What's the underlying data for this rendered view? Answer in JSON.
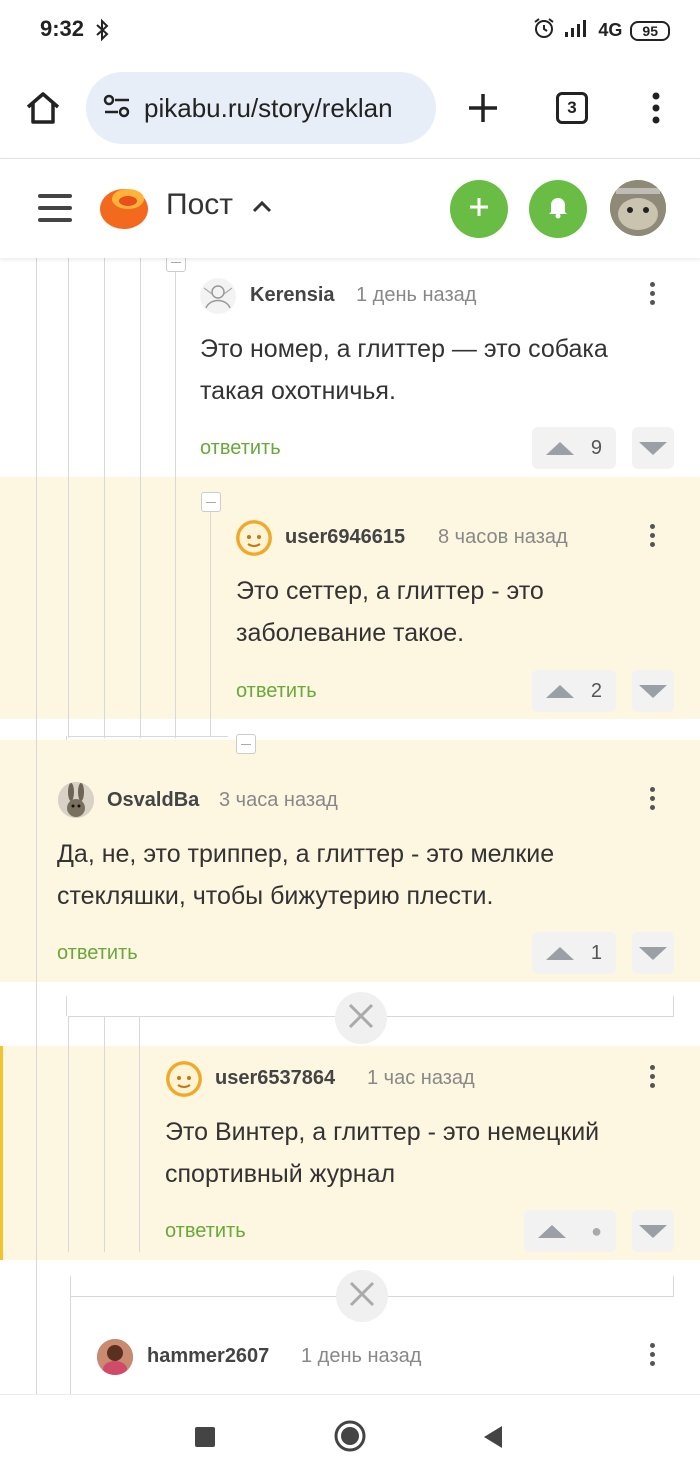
{
  "status_bar": {
    "time": "9:32",
    "network": "4G",
    "battery": "95"
  },
  "browser": {
    "url": "pikabu.ru/story/reklan",
    "tab_count": "3"
  },
  "header": {
    "title": "Пост"
  },
  "comments": [
    {
      "username": "Kerensia",
      "time": "1 день назад",
      "lines": [
        "Это номер, а глиттер — это собака",
        "такая охотничья."
      ],
      "reply": "ответить",
      "votes": "9"
    },
    {
      "username": "user6946615",
      "time": "8 часов назад",
      "lines": [
        "Это сеттер, а глиттер - это",
        "заболевание такое."
      ],
      "reply": "ответить",
      "votes": "2"
    },
    {
      "username": "OsvaldBa",
      "time": "3 часа назад",
      "lines": [
        "Да, не, это триппер, а глиттер - это мелкие",
        "стекляшки, чтобы бижутерию плести."
      ],
      "reply": "ответить",
      "votes": "1"
    },
    {
      "username": "user6537864",
      "time": "1 час назад",
      "lines": [
        "Это Винтер, а глиттер - это немецкий",
        "спортивный журнал"
      ],
      "reply": "ответить",
      "votes": "●"
    },
    {
      "username": "hammer2607",
      "time": "1 день назад"
    }
  ],
  "colors": {
    "accent_green": "#69bd45",
    "highlight_bg": "#fdf6e0",
    "reply_green": "#69a83a"
  },
  "icons": [
    "bluetooth-icon",
    "alarm-icon",
    "signal-icon",
    "home-icon",
    "site-settings-icon",
    "new-tab-plus-icon",
    "more-vert-icon",
    "hamburger-icon",
    "pikabu-logo",
    "chevron-up-icon",
    "add-post-icon",
    "bell-icon",
    "close-icon",
    "nav-square-icon",
    "nav-circle-icon",
    "nav-back-icon"
  ]
}
